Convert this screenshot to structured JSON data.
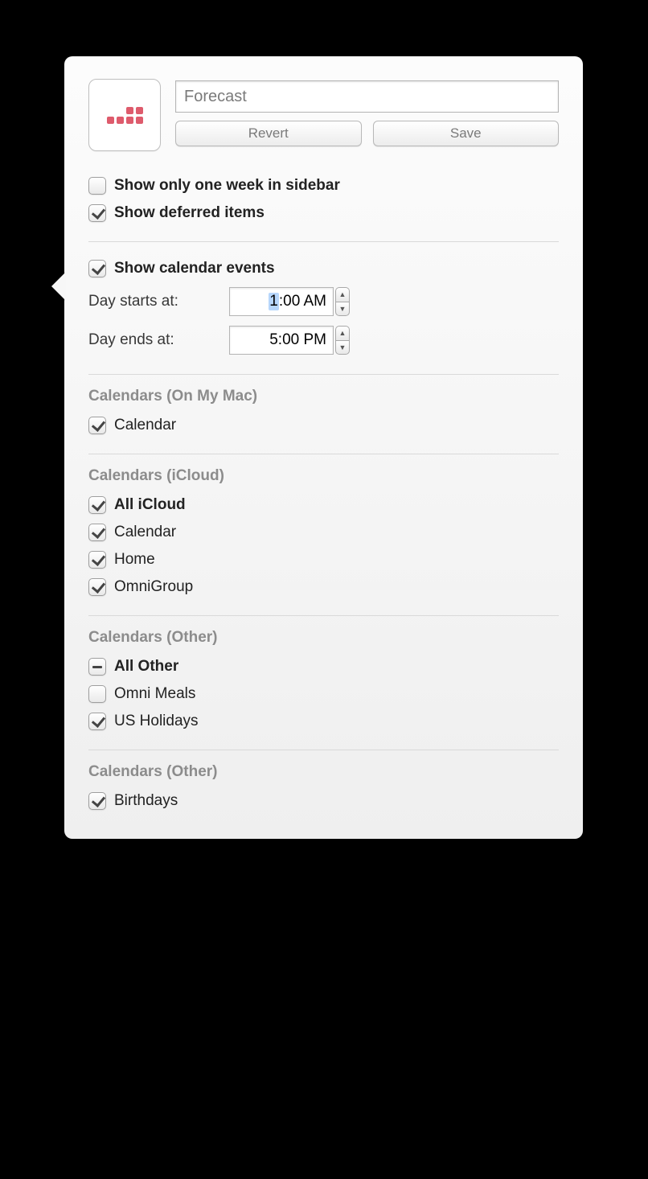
{
  "header": {
    "name_value": "Forecast",
    "revert_label": "Revert",
    "save_label": "Save"
  },
  "options": {
    "one_week_label": "Show only one week in sidebar",
    "one_week_checked": false,
    "deferred_label": "Show deferred items",
    "deferred_checked": true
  },
  "calendar_events": {
    "show_label": "Show calendar events",
    "show_checked": true,
    "day_starts_label": "Day starts at:",
    "day_starts_value": "1:00 AM",
    "day_starts_highlight": "1",
    "day_starts_rest": ":00 AM",
    "day_ends_label": "Day ends at:",
    "day_ends_value": "5:00 PM"
  },
  "groups": [
    {
      "title": "Calendars (On My Mac)",
      "items": [
        {
          "label": "Calendar",
          "state": "checked",
          "bold": false
        }
      ]
    },
    {
      "title": "Calendars (iCloud)",
      "items": [
        {
          "label": "All iCloud",
          "state": "checked",
          "bold": true
        },
        {
          "label": "Calendar",
          "state": "checked",
          "bold": false
        },
        {
          "label": "Home",
          "state": "checked",
          "bold": false
        },
        {
          "label": "OmniGroup",
          "state": "checked",
          "bold": false
        }
      ]
    },
    {
      "title": "Calendars (Other)",
      "items": [
        {
          "label": "All Other",
          "state": "mixed",
          "bold": true
        },
        {
          "label": "Omni Meals",
          "state": "unchecked",
          "bold": false
        },
        {
          "label": "US Holidays",
          "state": "checked",
          "bold": false
        }
      ]
    },
    {
      "title": "Calendars (Other)",
      "items": [
        {
          "label": "Birthdays",
          "state": "checked",
          "bold": false
        }
      ]
    }
  ]
}
